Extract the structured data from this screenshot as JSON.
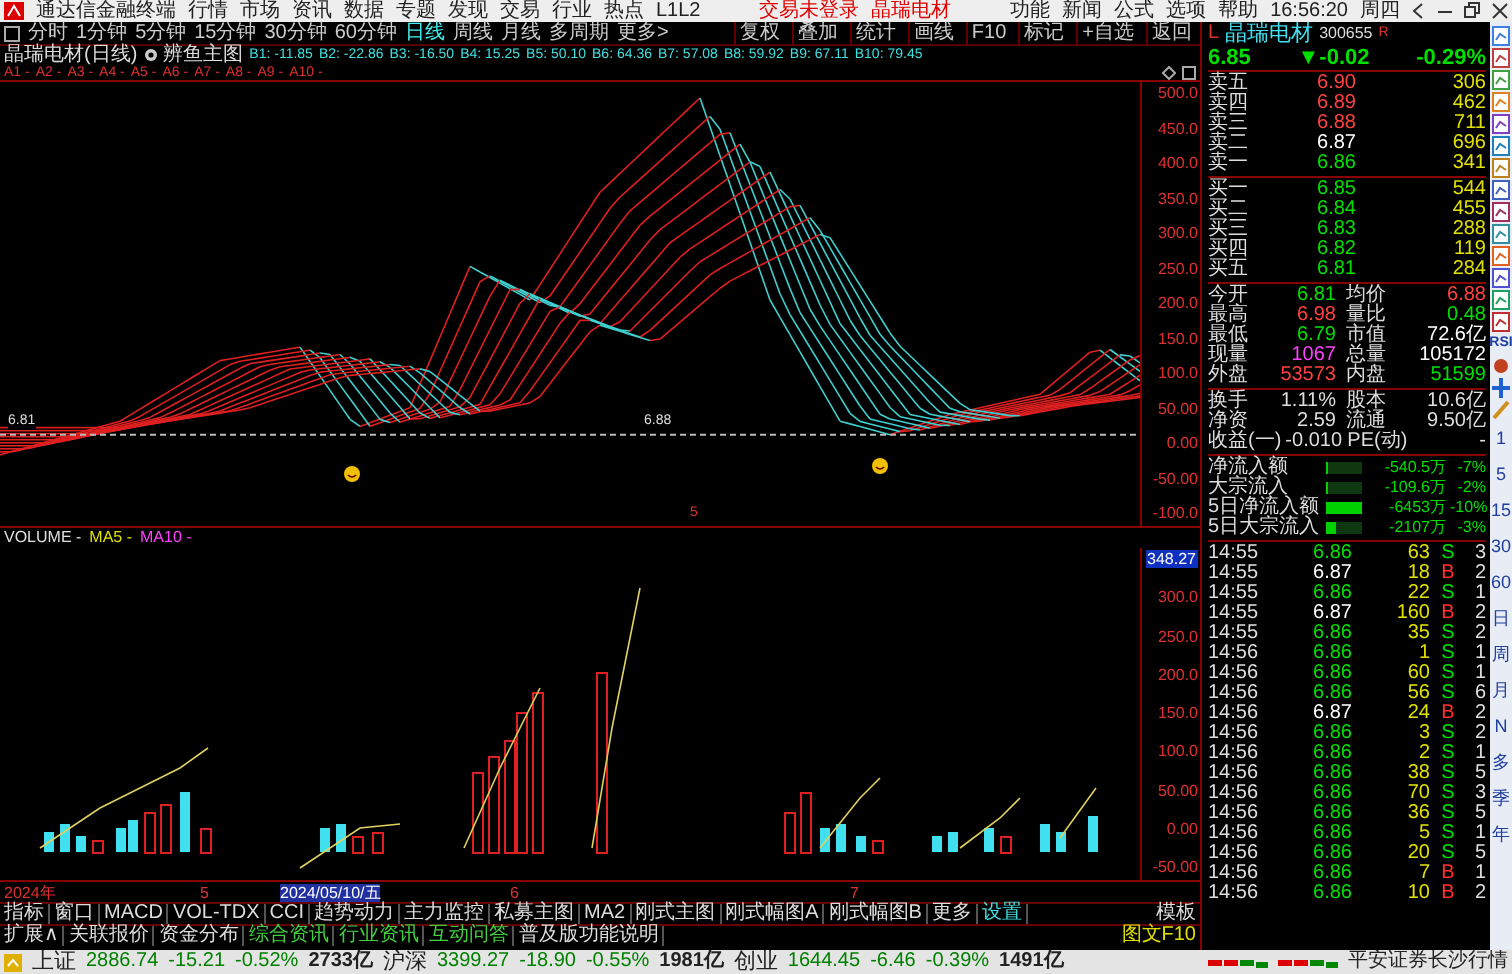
{
  "title_bar": {
    "app_name": "通达信金融终端",
    "menu": [
      "行情",
      "市场",
      "资讯",
      "数据",
      "专题",
      "发现",
      "交易",
      "行业",
      "热点",
      "L1L2"
    ],
    "login_status": "交易未登录",
    "stock_name": "晶瑞电材",
    "tools": [
      "功能",
      "新闻",
      "公式",
      "选项",
      "帮助"
    ],
    "clock": "16:56:20",
    "weekday": "周四"
  },
  "period_bar": {
    "periods": [
      {
        "label": "分时",
        "selected": false
      },
      {
        "label": "1分钟",
        "selected": false
      },
      {
        "label": "5分钟",
        "selected": false
      },
      {
        "label": "15分钟",
        "selected": false
      },
      {
        "label": "30分钟",
        "selected": false
      },
      {
        "label": "60分钟",
        "selected": false
      },
      {
        "label": "日线",
        "selected": true
      },
      {
        "label": "周线",
        "selected": false
      },
      {
        "label": "月线",
        "selected": false
      },
      {
        "label": "多周期",
        "selected": false
      },
      {
        "label": "更多>",
        "selected": false
      }
    ],
    "tools": [
      "复权",
      "叠加",
      "统计",
      "画线",
      "F10",
      "标记",
      "+自选",
      "返回"
    ]
  },
  "chart_header": {
    "title": "晶瑞电材(日线)",
    "indicator": "辨鱼主图",
    "b_values": [
      "B1: -11.85",
      "B2: -22.86",
      "B3: -16.50",
      "B4: 15.25",
      "B5: 50.10",
      "B6: 64.36",
      "B7: 57.08",
      "B8: 59.92",
      "B9: 67.11",
      "B10: 79.45"
    ],
    "a_values": [
      "A1 -",
      "A2 -",
      "A3 -",
      "A4 -",
      "A5 -",
      "A6 -",
      "A7 -",
      "A8 -",
      "A9 -",
      "A10 -"
    ]
  },
  "main_pane": {
    "line_labels": [
      "6.81",
      "6.88"
    ],
    "marker": "5",
    "y_axis": [
      "500.0",
      "450.0",
      "400.0",
      "350.0",
      "300.0",
      "250.0",
      "200.0",
      "150.0",
      "100.0",
      "50.00",
      "0.00",
      "-50.00",
      "-100.0"
    ]
  },
  "volume_pane": {
    "series": [
      {
        "label": "VOLUME -",
        "color": "#e0e0e0"
      },
      {
        "label": "MA5 -",
        "color": "#e0e000"
      },
      {
        "label": "MA10 -",
        "color": "#ff40ff"
      }
    ],
    "y_axis": [
      "348.27",
      "300.0",
      "250.0",
      "200.0",
      "150.0",
      "100.0",
      "50.00",
      "0.00",
      "-50.00"
    ]
  },
  "date_axis": [
    {
      "label": "2024年",
      "selected": false
    },
    {
      "label": "5",
      "selected": false
    },
    {
      "label": "2024/05/10/五",
      "selected": true
    },
    {
      "label": "6",
      "selected": false
    },
    {
      "label": "7",
      "selected": false
    }
  ],
  "indicator_tabs": [
    {
      "label": "指标",
      "kind": "tab"
    },
    {
      "label": "窗口",
      "kind": "tab"
    },
    {
      "label": "MACD",
      "kind": "tab"
    },
    {
      "label": "VOL-TDX",
      "kind": "tab"
    },
    {
      "label": "CCI",
      "kind": "tab"
    },
    {
      "label": "趋势动力",
      "kind": "tab"
    },
    {
      "label": "主力监控",
      "kind": "tab"
    },
    {
      "label": "私募主图",
      "kind": "tab"
    },
    {
      "label": "MA2",
      "kind": "tab"
    },
    {
      "label": "刚式主图",
      "kind": "tab"
    },
    {
      "label": "刚式幅图A",
      "kind": "tab"
    },
    {
      "label": "刚式幅图B",
      "kind": "tab"
    },
    {
      "label": "更多",
      "kind": "tab"
    },
    {
      "label": "设置",
      "kind": "link"
    }
  ],
  "template_button": "模板",
  "info_tabs": [
    {
      "label": "扩展∧",
      "kind": "tab"
    },
    {
      "label": "关联报价",
      "kind": "tab"
    },
    {
      "label": "资金分布",
      "kind": "tab"
    },
    {
      "label": "综合资讯",
      "kind": "news"
    },
    {
      "label": "行业资讯",
      "kind": "news"
    },
    {
      "label": "互动问答",
      "kind": "news"
    },
    {
      "label": "普及版功能说明",
      "kind": "tab"
    }
  ],
  "f10_button": "图文F10",
  "quote": {
    "badge": "L",
    "name": "晶瑞电材",
    "code": "300655",
    "mark": "R",
    "price": "6.85",
    "change": "▼-0.02",
    "percent": "-0.29%",
    "asks": [
      {
        "label": "卖五",
        "price": "6.90",
        "color": "#ff4040",
        "volume": "306"
      },
      {
        "label": "卖四",
        "price": "6.89",
        "color": "#ff4040",
        "volume": "462"
      },
      {
        "label": "卖三",
        "price": "6.88",
        "color": "#ff4040",
        "volume": "711"
      },
      {
        "label": "卖二",
        "price": "6.87",
        "color": "#ffffff",
        "volume": "696"
      },
      {
        "label": "卖一",
        "price": "6.86",
        "color": "#00e000",
        "volume": "341"
      }
    ],
    "bids": [
      {
        "label": "买一",
        "price": "6.85",
        "color": "#00e000",
        "volume": "544"
      },
      {
        "label": "买二",
        "price": "6.84",
        "color": "#00e000",
        "volume": "455"
      },
      {
        "label": "买三",
        "price": "6.83",
        "color": "#00e000",
        "volume": "288"
      },
      {
        "label": "买四",
        "price": "6.82",
        "color": "#00e000",
        "volume": "119"
      },
      {
        "label": "买五",
        "price": "6.81",
        "color": "#00e000",
        "volume": "284"
      }
    ],
    "stats": [
      {
        "label": "今开",
        "value": "6.81",
        "color": "#00e000"
      },
      {
        "label": "均价",
        "value": "6.88",
        "color": "#ff4040"
      },
      {
        "label": "最高",
        "value": "6.98",
        "color": "#ff4040"
      },
      {
        "label": "量比",
        "value": "0.48",
        "color": "#00e000"
      },
      {
        "label": "最低",
        "value": "6.79",
        "color": "#00e000"
      },
      {
        "label": "市值",
        "value": "72.6亿",
        "color": "#ffffff"
      },
      {
        "label": "现量",
        "value": "1067",
        "color": "#ff40ff"
      },
      {
        "label": "总量",
        "value": "105172",
        "color": "#ffffff"
      },
      {
        "label": "外盘",
        "value": "53573",
        "color": "#ff4040"
      },
      {
        "label": "内盘",
        "value": "51599",
        "color": "#00e000"
      }
    ],
    "fundamentals": [
      {
        "label": "换手",
        "value": "1.11%",
        "label2": "股本",
        "value2": "10.6亿"
      },
      {
        "label": "净资",
        "value": "2.59",
        "label2": "流通",
        "value2": "9.50亿"
      },
      {
        "label": "收益(一)",
        "value": "-0.010",
        "label2": "PE(动)",
        "value2": "-"
      }
    ],
    "flows": [
      {
        "label": "净流入额",
        "level": 0.04,
        "amount": "-540.5万",
        "percent": "-7%"
      },
      {
        "label": "大宗流入",
        "level": 0.04,
        "amount": "-109.6万",
        "percent": "-2%"
      },
      {
        "label": "5日净流入额",
        "level": 1,
        "amount": "-6453万",
        "percent": "-10%"
      },
      {
        "label": "5日大宗流入",
        "level": 0.25,
        "amount": "-2107万",
        "percent": "-3%"
      }
    ],
    "trades": [
      {
        "time": "14:55",
        "price": "6.86",
        "color": "#00e000",
        "volume": "63",
        "side": "S",
        "count": "3"
      },
      {
        "time": "14:55",
        "price": "6.87",
        "color": "#ffffff",
        "volume": "18",
        "side": "B",
        "count": "2"
      },
      {
        "time": "14:55",
        "price": "6.86",
        "color": "#00e000",
        "volume": "22",
        "side": "S",
        "count": "1"
      },
      {
        "time": "14:55",
        "price": "6.87",
        "color": "#ffffff",
        "volume": "160",
        "side": "B",
        "count": "2"
      },
      {
        "time": "14:55",
        "price": "6.86",
        "color": "#00e000",
        "volume": "35",
        "side": "S",
        "count": "2"
      },
      {
        "time": "14:56",
        "price": "6.86",
        "color": "#00e000",
        "volume": "1",
        "side": "S",
        "count": "1"
      },
      {
        "time": "14:56",
        "price": "6.86",
        "color": "#00e000",
        "volume": "60",
        "side": "S",
        "count": "1"
      },
      {
        "time": "14:56",
        "price": "6.86",
        "color": "#00e000",
        "volume": "56",
        "side": "S",
        "count": "6"
      },
      {
        "time": "14:56",
        "price": "6.87",
        "color": "#ffffff",
        "volume": "24",
        "side": "B",
        "count": "2"
      },
      {
        "time": "14:56",
        "price": "6.86",
        "color": "#00e000",
        "volume": "3",
        "side": "S",
        "count": "2"
      },
      {
        "time": "14:56",
        "price": "6.86",
        "color": "#00e000",
        "volume": "2",
        "side": "S",
        "count": "1"
      },
      {
        "time": "14:56",
        "price": "6.86",
        "color": "#00e000",
        "volume": "38",
        "side": "S",
        "count": "5"
      },
      {
        "time": "14:56",
        "price": "6.86",
        "color": "#00e000",
        "volume": "70",
        "side": "S",
        "count": "3"
      },
      {
        "time": "14:56",
        "price": "6.86",
        "color": "#00e000",
        "volume": "36",
        "side": "S",
        "count": "5"
      },
      {
        "time": "14:56",
        "price": "6.86",
        "color": "#00e000",
        "volume": "5",
        "side": "S",
        "count": "1"
      },
      {
        "time": "14:56",
        "price": "6.86",
        "color": "#00e000",
        "volume": "20",
        "side": "S",
        "count": "5"
      },
      {
        "time": "14:56",
        "price": "6.86",
        "color": "#00e000",
        "volume": "7",
        "side": "B",
        "count": "1"
      },
      {
        "time": "14:56",
        "price": "6.86",
        "color": "#00e000",
        "volume": "10",
        "side": "B",
        "count": "2"
      }
    ]
  },
  "side_toolbar": {
    "tool_label": "RSI",
    "periods": [
      "1",
      "5",
      "15",
      "30",
      "60",
      "日",
      "周",
      "月",
      "N",
      "多",
      "季",
      "年"
    ]
  },
  "status_bar": {
    "indices": [
      {
        "name": "上证",
        "value": "2886.74",
        "change": "-15.21",
        "percent": "-0.52%",
        "amount": "2733亿",
        "color": "#008000"
      },
      {
        "name": "沪深",
        "value": "3399.27",
        "change": "-18.90",
        "percent": "-0.55%",
        "amount": "1981亿",
        "color": "#008000"
      },
      {
        "name": "创业",
        "value": "1644.45",
        "change": "-6.46",
        "percent": "-0.39%",
        "amount": "1491亿",
        "color": "#008000"
      }
    ],
    "broker": "平安证券长沙行情"
  }
}
